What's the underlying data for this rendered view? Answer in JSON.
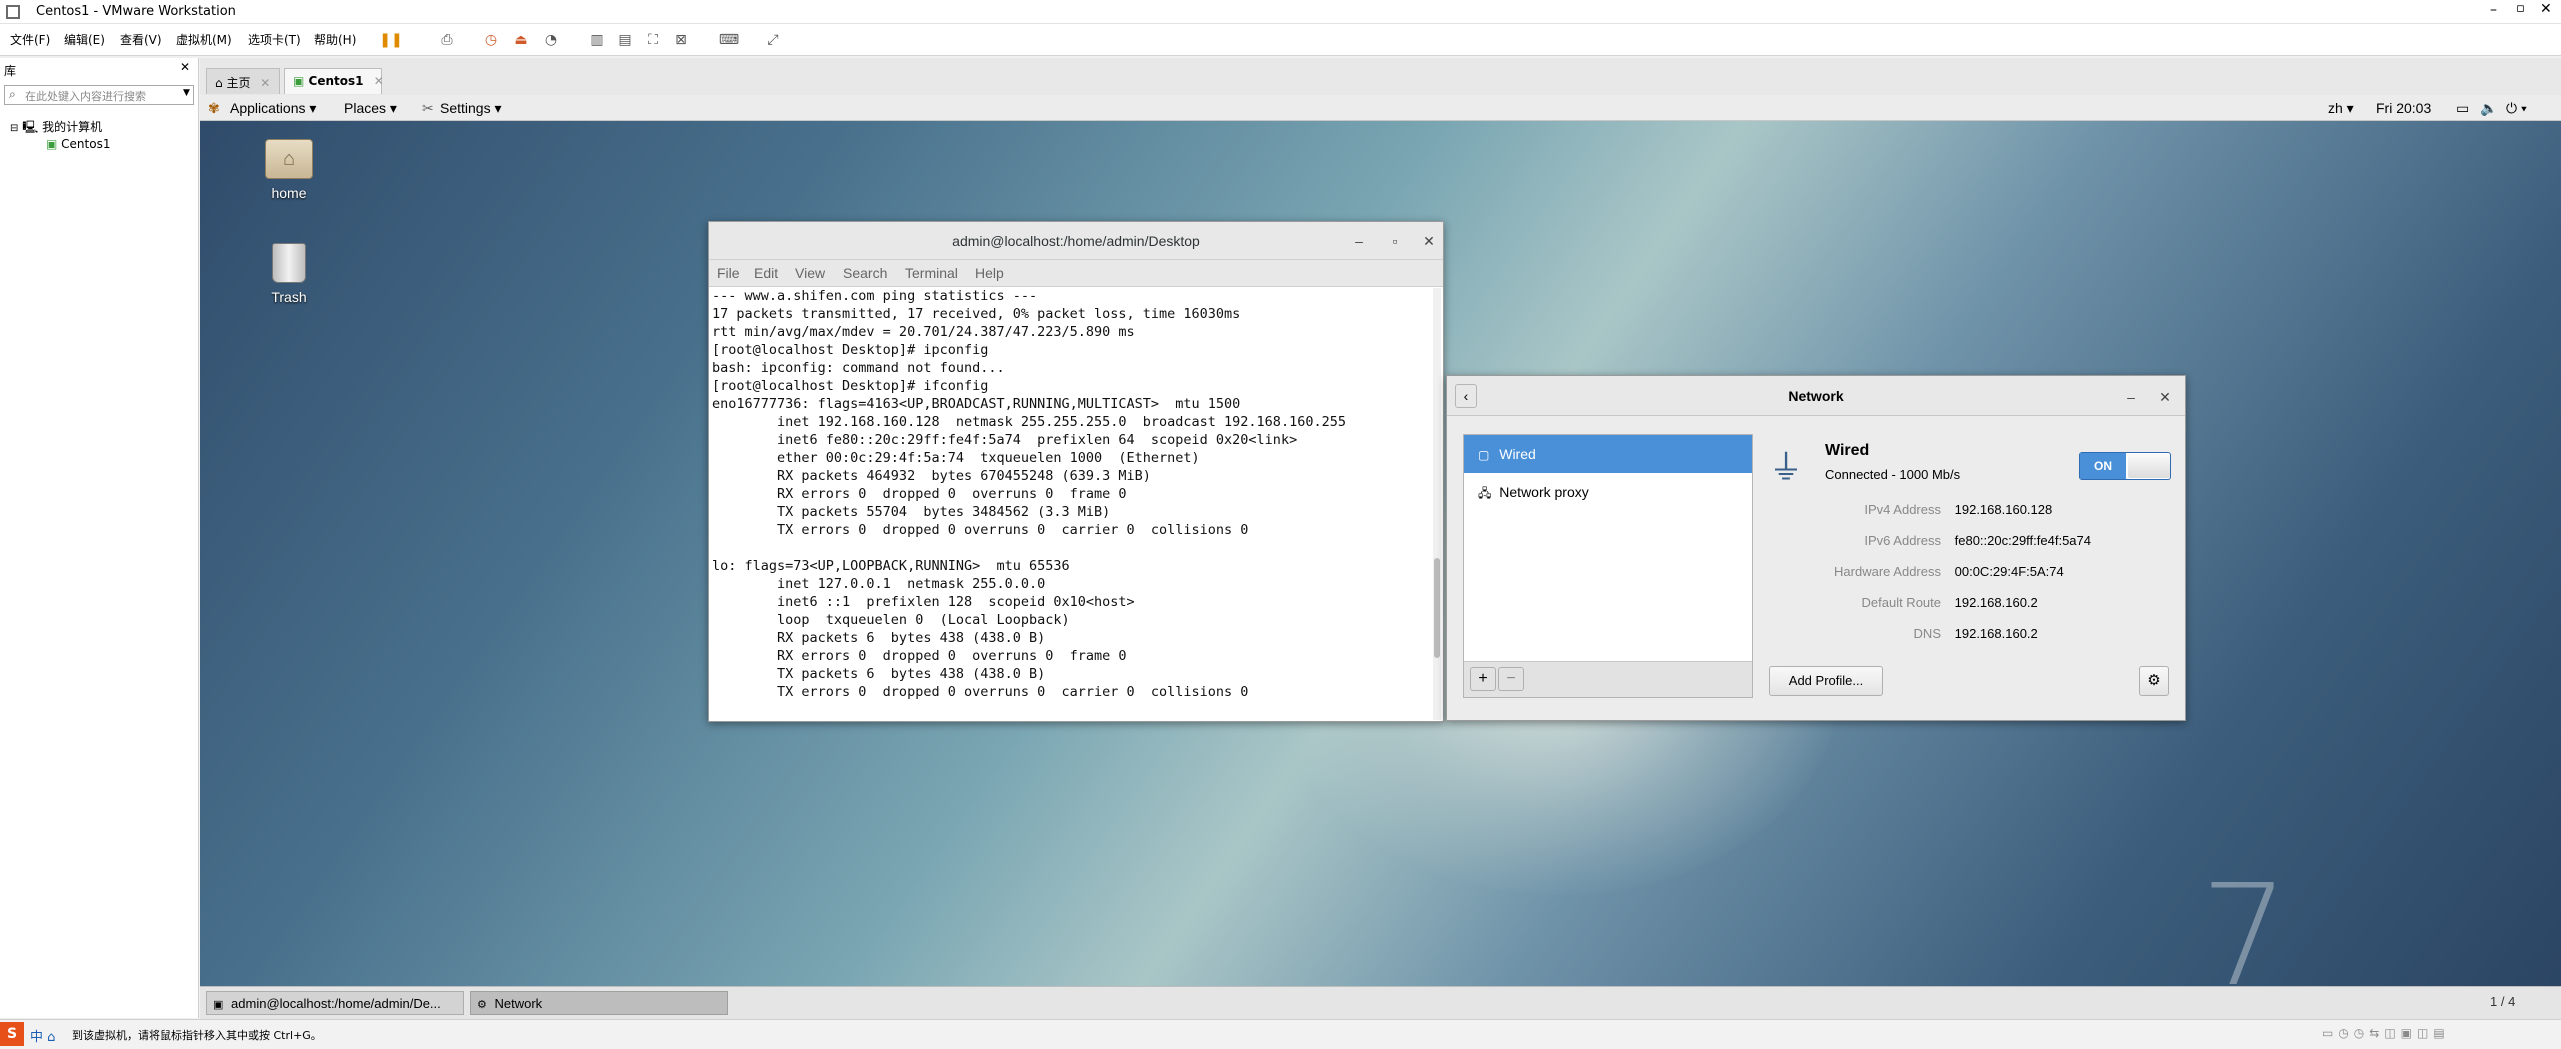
{
  "window": {
    "title": "Centos1 - VMware Workstation"
  },
  "menu": [
    "文件(F)",
    "编辑(E)",
    "查看(V)",
    "虚拟机(M)",
    "选项卡(T)",
    "帮助(H)"
  ],
  "library": {
    "title": "库",
    "search_placeholder": "在此处键入内容进行搜索",
    "tree_root": "我的计算机",
    "tree_child": "Centos1"
  },
  "tabs": {
    "home": "主页",
    "vm": "Centos1"
  },
  "gnome": {
    "applications": "Applications",
    "places": "Places",
    "settings": "Settings",
    "lang": "zh",
    "clock": "Fri 20:03"
  },
  "desktop": {
    "home_label": "home",
    "trash_label": "Trash",
    "watermark": "7"
  },
  "terminal": {
    "title": "admin@localhost:/home/admin/Desktop",
    "menu": [
      "File",
      "Edit",
      "View",
      "Search",
      "Terminal",
      "Help"
    ],
    "output": "--- www.a.shifen.com ping statistics ---\n17 packets transmitted, 17 received, 0% packet loss, time 16030ms\nrtt min/avg/max/mdev = 20.701/24.387/47.223/5.890 ms\n[root@localhost Desktop]# ipconfig\nbash: ipconfig: command not found...\n[root@localhost Desktop]# ifconfig\neno16777736: flags=4163<UP,BROADCAST,RUNNING,MULTICAST>  mtu 1500\n        inet 192.168.160.128  netmask 255.255.255.0  broadcast 192.168.160.255\n        inet6 fe80::20c:29ff:fe4f:5a74  prefixlen 64  scopeid 0x20<link>\n        ether 00:0c:29:4f:5a:74  txqueuelen 1000  (Ethernet)\n        RX packets 464932  bytes 670455248 (639.3 MiB)\n        RX errors 0  dropped 0  overruns 0  frame 0\n        TX packets 55704  bytes 3484562 (3.3 MiB)\n        TX errors 0  dropped 0 overruns 0  carrier 0  collisions 0\n\nlo: flags=73<UP,LOOPBACK,RUNNING>  mtu 65536\n        inet 127.0.0.1  netmask 255.0.0.0\n        inet6 ::1  prefixlen 128  scopeid 0x10<host>\n        loop  txqueuelen 0  (Local Loopback)\n        RX packets 6  bytes 438 (438.0 B)\n        RX errors 0  dropped 0  overruns 0  frame 0\n        TX packets 6  bytes 438 (438.0 B)\n        TX errors 0  dropped 0 overruns 0  carrier 0  collisions 0"
  },
  "network": {
    "title": "Network",
    "list": [
      "Wired",
      "Network proxy"
    ],
    "wired_title": "Wired",
    "wired_status": "Connected - 1000 Mb/s",
    "toggle": "ON",
    "details": [
      {
        "label": "IPv4 Address",
        "value": "192.168.160.128"
      },
      {
        "label": "IPv6 Address",
        "value": "fe80::20c:29ff:fe4f:5a74"
      },
      {
        "label": "Hardware Address",
        "value": "00:0C:29:4F:5A:74"
      },
      {
        "label": "Default Route",
        "value": "192.168.160.2"
      },
      {
        "label": "DNS",
        "value": "192.168.160.2"
      }
    ],
    "add_profile": "Add Profile..."
  },
  "taskbar": {
    "item1": "admin@localhost:/home/admin/De...",
    "item2": "Network",
    "pager": "1 / 4"
  },
  "status": {
    "hint": "到该虚拟机，请将鼠标指针移入其中或按 Ctrl+G。"
  }
}
